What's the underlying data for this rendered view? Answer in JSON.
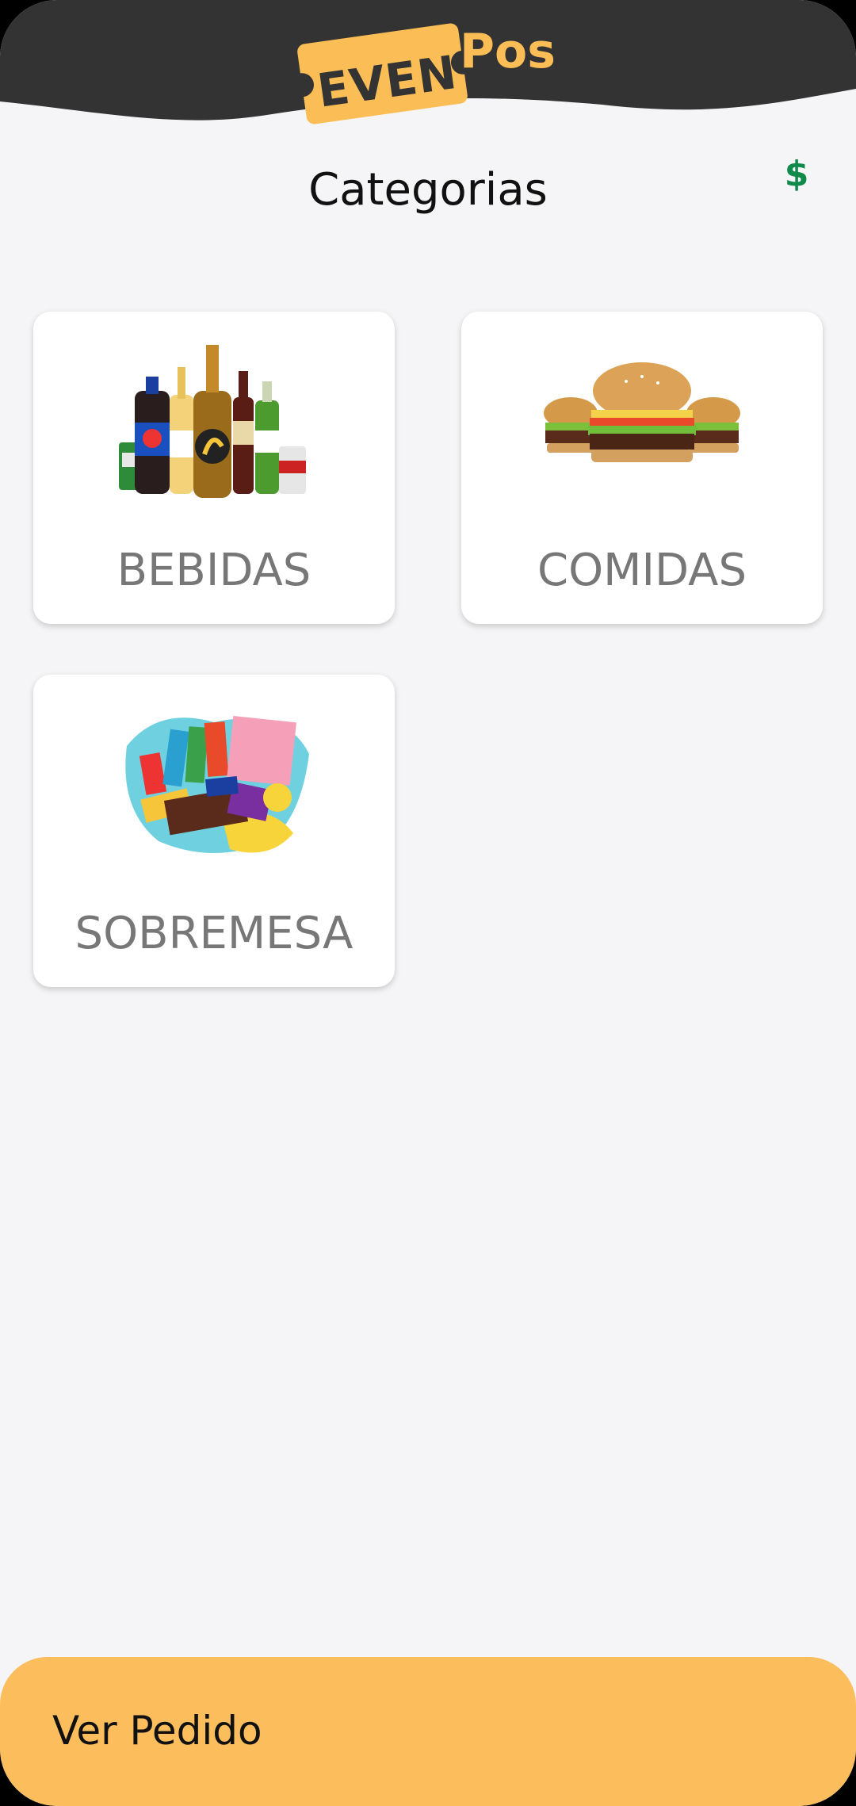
{
  "header": {
    "logo_word_1": "EVENT",
    "logo_word_2": "Pos",
    "background_color": "#333333",
    "accent_color": "#fbbd55"
  },
  "page_title": "Categorias",
  "currency_button": {
    "label": "$",
    "color": "#0f8a4a"
  },
  "categories": [
    {
      "label": "BEBIDAS",
      "image": "drinks-bottles-image"
    },
    {
      "label": "COMIDAS",
      "image": "burgers-image"
    },
    {
      "label": "SOBREMESA",
      "image": "candy-sweets-image"
    }
  ],
  "footer": {
    "label": "Ver Pedido",
    "color": "#fcbd5c"
  }
}
